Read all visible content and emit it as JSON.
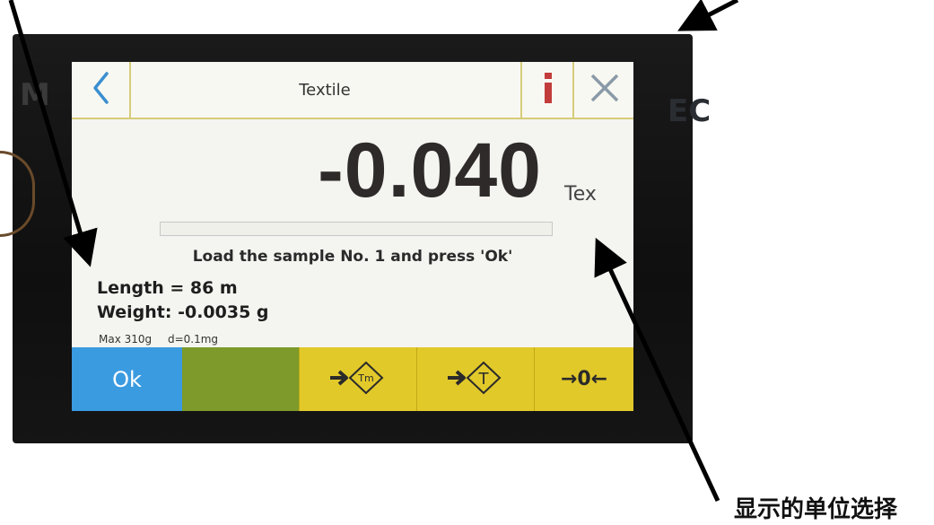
{
  "screen": {
    "title": "Textile",
    "display_value": "-0.040",
    "unit": "Tex",
    "progress": 0,
    "prompt": "Load the sample No. 1 and press 'Ok'",
    "length": "Length = 86 m",
    "weight": "Weight: -0.0035 g",
    "max_capacity": "Max 310g",
    "resolution": "d=0.1mg"
  },
  "buttons": {
    "ok_label": "Ok",
    "zero_label": "→0←",
    "tare_memory_icon": "tare-memory-icon",
    "tare_icon": "tare-icon",
    "back_icon": "chevron-left-icon",
    "info_icon": "info-icon",
    "close_icon": "close-icon"
  },
  "bezel": {
    "left_mark": "M",
    "right_mark": "EC"
  },
  "annotation": {
    "caption": "显示的单位选择"
  },
  "colors": {
    "accent_blue": "#3b9be0",
    "olive": "#7d9a2a",
    "yellow": "#e2c92a",
    "border_gold": "#d6cc7a"
  }
}
